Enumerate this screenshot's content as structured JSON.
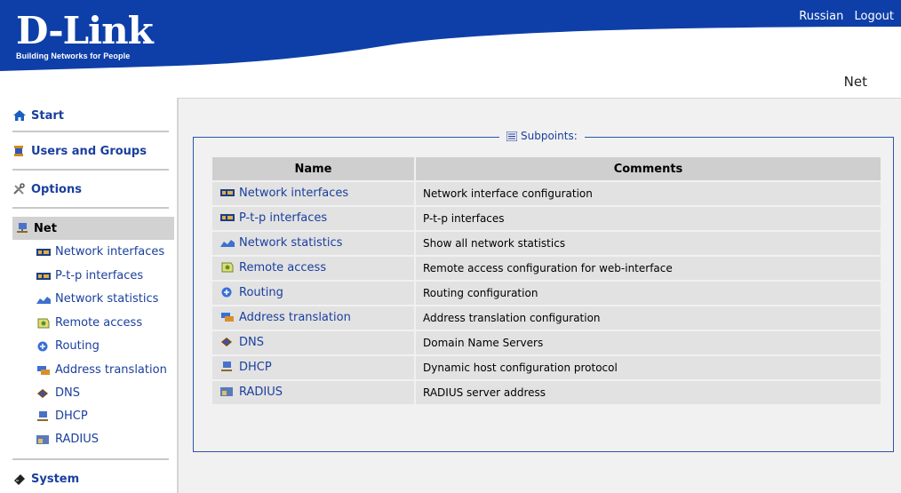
{
  "header": {
    "logo_text": "D-Link",
    "logo_tagline": "Building Networks for People",
    "links": [
      "Russian",
      "Logout"
    ],
    "page_title": "Net"
  },
  "colors": {
    "brand_blue": "#0e3fa8",
    "link_blue": "#1a3f9e",
    "active_bg": "#d2d2d2"
  },
  "sidebar": {
    "sections": [
      {
        "label": "Start",
        "icon": "home-icon"
      },
      {
        "label": "Users and Groups",
        "icon": "users-icon"
      },
      {
        "label": "Options",
        "icon": "tools-icon"
      },
      {
        "label": "Net",
        "icon": "network-icon",
        "active": true
      },
      {
        "label": "System",
        "icon": "system-icon"
      }
    ],
    "net_items": [
      {
        "label": "Network interfaces",
        "icon": "network-card-icon"
      },
      {
        "label": "P-t-p interfaces",
        "icon": "network-card-icon"
      },
      {
        "label": "Network statistics",
        "icon": "statistics-icon"
      },
      {
        "label": "Remote access",
        "icon": "remote-access-icon"
      },
      {
        "label": "Routing",
        "icon": "routing-icon"
      },
      {
        "label": "Address translation",
        "icon": "address-translation-icon"
      },
      {
        "label": "DNS",
        "icon": "dns-icon"
      },
      {
        "label": "DHCP",
        "icon": "dhcp-icon"
      },
      {
        "label": "RADIUS",
        "icon": "radius-icon"
      }
    ]
  },
  "main": {
    "legend": "Subpoints:",
    "columns": [
      "Name",
      "Comments"
    ],
    "rows": [
      {
        "name": "Network interfaces",
        "comment": "Network interface configuration",
        "icon": "network-card-icon"
      },
      {
        "name": "P-t-p interfaces",
        "comment": "P-t-p interfaces",
        "icon": "network-card-icon"
      },
      {
        "name": "Network statistics",
        "comment": "Show all network statistics",
        "icon": "statistics-icon"
      },
      {
        "name": "Remote access",
        "comment": "Remote access configuration for web-interface",
        "icon": "remote-access-icon"
      },
      {
        "name": "Routing",
        "comment": "Routing configuration",
        "icon": "routing-icon"
      },
      {
        "name": "Address translation",
        "comment": "Address translation configuration",
        "icon": "address-translation-icon"
      },
      {
        "name": "DNS",
        "comment": "Domain Name Servers",
        "icon": "dns-icon"
      },
      {
        "name": "DHCP",
        "comment": "Dynamic host configuration protocol",
        "icon": "dhcp-icon"
      },
      {
        "name": "RADIUS",
        "comment": "RADIUS server address",
        "icon": "radius-icon"
      }
    ]
  }
}
